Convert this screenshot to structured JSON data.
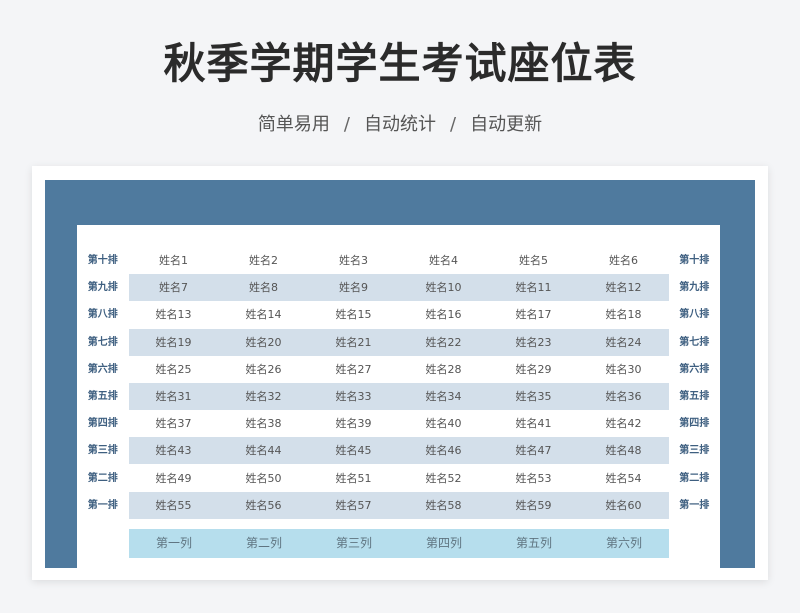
{
  "header": {
    "title": "秋季学期学生考试座位表",
    "subtitle_items": [
      "简单易用",
      "自动统计",
      "自动更新"
    ],
    "subtitle_separator": "/"
  },
  "colors": {
    "frame": "#4f7a9e",
    "alt_row": "#d3dfea",
    "column_bar": "#b6deed",
    "row_label": "#3e5f80"
  },
  "rows": [
    {
      "label": "第十排",
      "seats": [
        "姓名1",
        "姓名2",
        "姓名3",
        "姓名4",
        "姓名5",
        "姓名6"
      ]
    },
    {
      "label": "第九排",
      "seats": [
        "姓名7",
        "姓名8",
        "姓名9",
        "姓名10",
        "姓名11",
        "姓名12"
      ]
    },
    {
      "label": "第八排",
      "seats": [
        "姓名13",
        "姓名14",
        "姓名15",
        "姓名16",
        "姓名17",
        "姓名18"
      ]
    },
    {
      "label": "第七排",
      "seats": [
        "姓名19",
        "姓名20",
        "姓名21",
        "姓名22",
        "姓名23",
        "姓名24"
      ]
    },
    {
      "label": "第六排",
      "seats": [
        "姓名25",
        "姓名26",
        "姓名27",
        "姓名28",
        "姓名29",
        "姓名30"
      ]
    },
    {
      "label": "第五排",
      "seats": [
        "姓名31",
        "姓名32",
        "姓名33",
        "姓名34",
        "姓名35",
        "姓名36"
      ]
    },
    {
      "label": "第四排",
      "seats": [
        "姓名37",
        "姓名38",
        "姓名39",
        "姓名40",
        "姓名41",
        "姓名42"
      ]
    },
    {
      "label": "第三排",
      "seats": [
        "姓名43",
        "姓名44",
        "姓名45",
        "姓名46",
        "姓名47",
        "姓名48"
      ]
    },
    {
      "label": "第二排",
      "seats": [
        "姓名49",
        "姓名50",
        "姓名51",
        "姓名52",
        "姓名53",
        "姓名54"
      ]
    },
    {
      "label": "第一排",
      "seats": [
        "姓名55",
        "姓名56",
        "姓名57",
        "姓名58",
        "姓名59",
        "姓名60"
      ]
    }
  ],
  "columns": [
    "第一列",
    "第二列",
    "第三列",
    "第四列",
    "第五列",
    "第六列"
  ]
}
